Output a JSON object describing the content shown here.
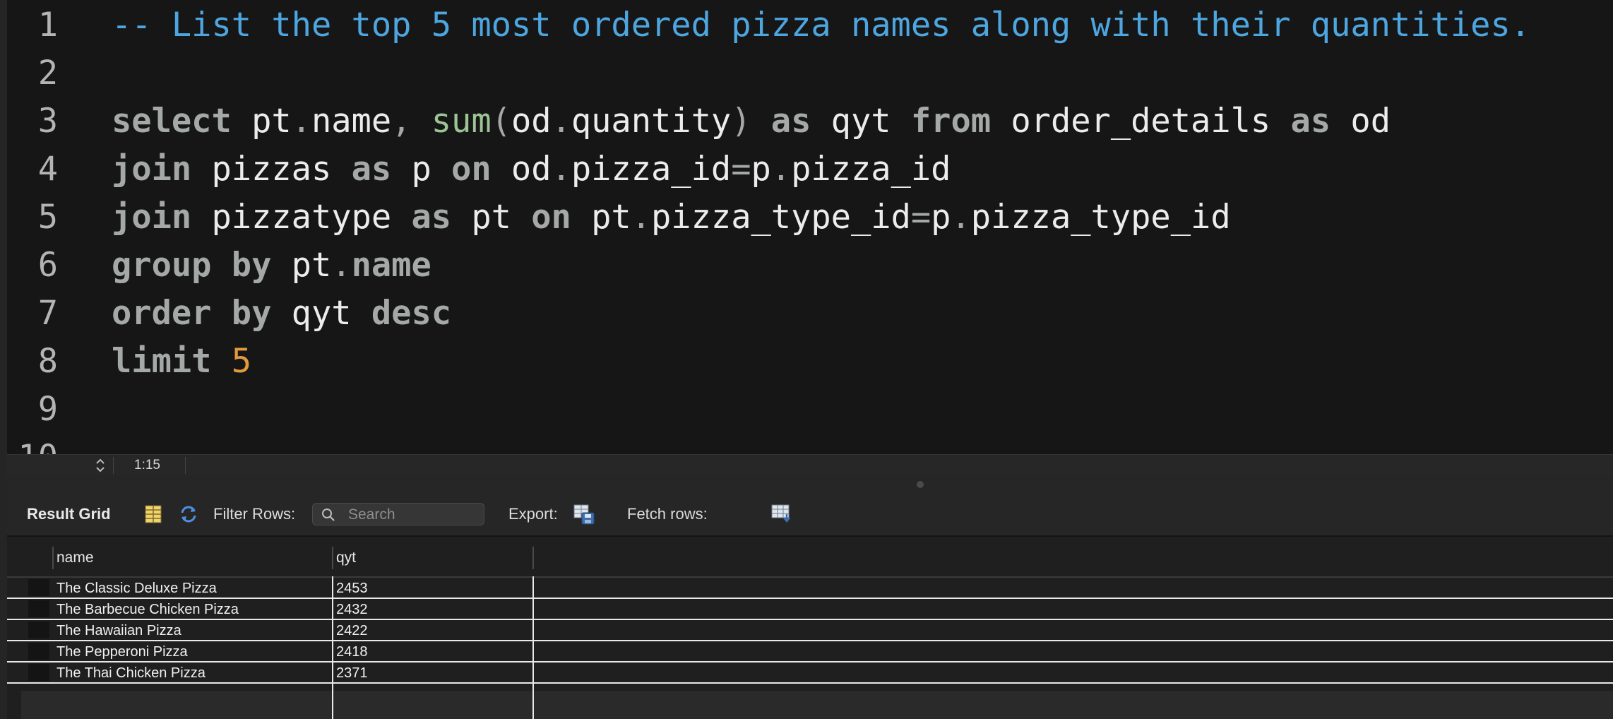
{
  "editor": {
    "lines": [
      {
        "num": "1",
        "tokens": [
          {
            "t": "cm",
            "v": "-- List the top 5 most ordered pizza names along with their quantities."
          }
        ]
      },
      {
        "num": "2",
        "tokens": []
      },
      {
        "num": "3",
        "tokens": [
          {
            "t": "kw",
            "v": "select"
          },
          {
            "t": "id",
            "v": " pt"
          },
          {
            "t": "pn",
            "v": "."
          },
          {
            "t": "id",
            "v": "name"
          },
          {
            "t": "pn",
            "v": ", "
          },
          {
            "t": "fn",
            "v": "sum"
          },
          {
            "t": "pn",
            "v": "("
          },
          {
            "t": "id",
            "v": "od"
          },
          {
            "t": "pn",
            "v": "."
          },
          {
            "t": "id",
            "v": "quantity"
          },
          {
            "t": "pn",
            "v": ")"
          },
          {
            "t": "kw",
            "v": " as"
          },
          {
            "t": "id",
            "v": " qyt "
          },
          {
            "t": "kw",
            "v": "from"
          },
          {
            "t": "id",
            "v": " order_details "
          },
          {
            "t": "kw",
            "v": "as"
          },
          {
            "t": "id",
            "v": " od"
          }
        ]
      },
      {
        "num": "4",
        "tokens": [
          {
            "t": "kw",
            "v": "join"
          },
          {
            "t": "id",
            "v": " pizzas "
          },
          {
            "t": "kw",
            "v": "as"
          },
          {
            "t": "id",
            "v": " p "
          },
          {
            "t": "kw",
            "v": "on"
          },
          {
            "t": "id",
            "v": " od"
          },
          {
            "t": "pn",
            "v": "."
          },
          {
            "t": "id",
            "v": "pizza_id"
          },
          {
            "t": "pn",
            "v": "="
          },
          {
            "t": "id",
            "v": "p"
          },
          {
            "t": "pn",
            "v": "."
          },
          {
            "t": "id",
            "v": "pizza_id"
          }
        ]
      },
      {
        "num": "5",
        "tokens": [
          {
            "t": "kw",
            "v": "join"
          },
          {
            "t": "id",
            "v": " pizzatype "
          },
          {
            "t": "kw",
            "v": "as"
          },
          {
            "t": "id",
            "v": " pt "
          },
          {
            "t": "kw",
            "v": "on"
          },
          {
            "t": "id",
            "v": " pt"
          },
          {
            "t": "pn",
            "v": "."
          },
          {
            "t": "id",
            "v": "pizza_type_id"
          },
          {
            "t": "pn",
            "v": "="
          },
          {
            "t": "id",
            "v": "p"
          },
          {
            "t": "pn",
            "v": "."
          },
          {
            "t": "id",
            "v": "pizza_type_id"
          }
        ]
      },
      {
        "num": "6",
        "tokens": [
          {
            "t": "kw",
            "v": "group by"
          },
          {
            "t": "id",
            "v": " pt"
          },
          {
            "t": "pn",
            "v": "."
          },
          {
            "t": "kw",
            "v": "name"
          }
        ]
      },
      {
        "num": "7",
        "tokens": [
          {
            "t": "kw",
            "v": "order by"
          },
          {
            "t": "id",
            "v": " qyt "
          },
          {
            "t": "kw",
            "v": "desc"
          }
        ]
      },
      {
        "num": "8",
        "tokens": [
          {
            "t": "kw",
            "v": "limit"
          },
          {
            "t": "num",
            "v": " 5"
          }
        ]
      },
      {
        "num": "9",
        "tokens": []
      },
      {
        "num": "10",
        "tokens": []
      }
    ]
  },
  "statusbar": {
    "cursor_position": "1:15"
  },
  "toolbar": {
    "result_grid_label": "Result Grid",
    "filter_rows_label": "Filter Rows:",
    "search_placeholder": "Search",
    "export_label": "Export:",
    "fetch_rows_label": "Fetch rows:"
  },
  "grid": {
    "columns": [
      "name",
      "qyt"
    ],
    "rows": [
      [
        "The Classic Deluxe Pizza",
        "2453"
      ],
      [
        "The Barbecue Chicken Pizza",
        "2432"
      ],
      [
        "The Hawaiian Pizza",
        "2422"
      ],
      [
        "The Pepperoni Pizza",
        "2418"
      ],
      [
        "The Thai Chicken Pizza",
        "2371"
      ]
    ]
  },
  "colors": {
    "keyword": "#a4a8a6",
    "comment": "#4da6e0",
    "function": "#9cc495",
    "number": "#e39a3d",
    "identifier": "#ececec"
  },
  "icons": {
    "status": "up-down-arrows-icon",
    "grid_view": "grid-view-icon",
    "refresh": "refresh-icon",
    "search": "search-icon",
    "export": "export-icon",
    "fetch_rows": "fetch-rows-icon"
  }
}
